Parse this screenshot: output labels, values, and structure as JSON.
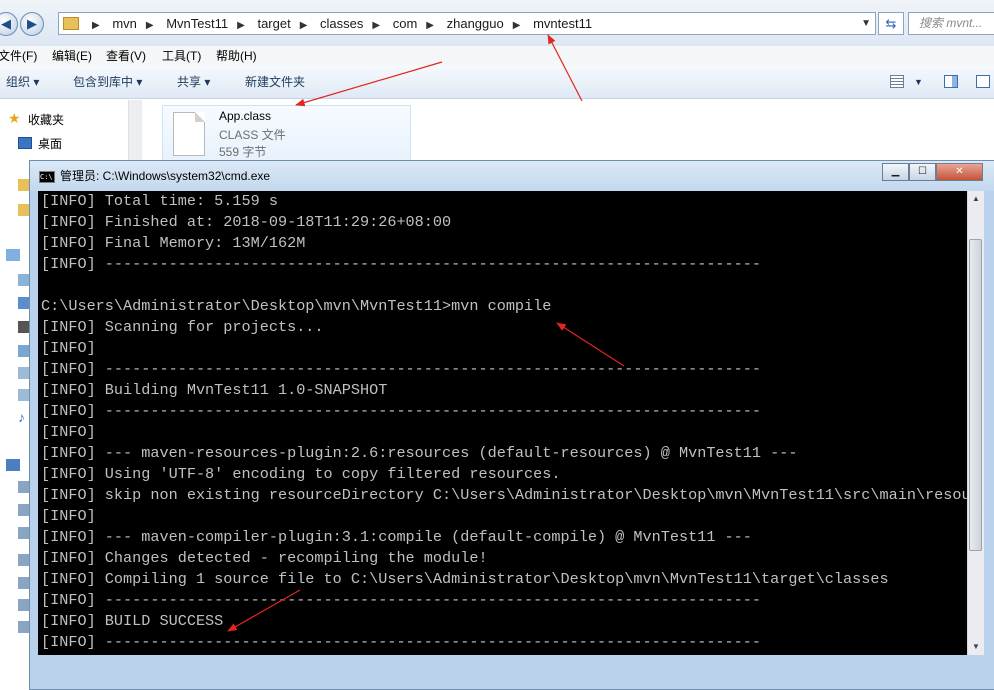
{
  "explorer": {
    "breadcrumb": [
      "mvn",
      "MvnTest11",
      "target",
      "classes",
      "com",
      "zhangguo",
      "mvntest11"
    ],
    "search_placeholder": "搜索 mvnt...",
    "menu": [
      "文件(F)",
      "编辑(E)",
      "查看(V)",
      "工具(T)",
      "帮助(H)"
    ],
    "toolbar": {
      "organize": "组织 ▾",
      "include_library": "包含到库中 ▾",
      "share": "共享 ▾",
      "new_folder": "新建文件夹"
    },
    "nav": {
      "favorites": "收藏夹",
      "desktop": "桌面"
    },
    "file": {
      "name": "App.class",
      "type": "CLASS 文件",
      "size": "559 字节"
    }
  },
  "cmd": {
    "title": "管理员: C:\\Windows\\system32\\cmd.exe",
    "icon_text": "C:\\",
    "lines": [
      "[INFO] Total time: 5.159 s",
      "[INFO] Finished at: 2018-09-18T11:29:26+08:00",
      "[INFO] Final Memory: 13M/162M",
      "[INFO] ------------------------------------------------------------------------",
      "",
      "C:\\Users\\Administrator\\Desktop\\mvn\\MvnTest11>mvn compile",
      "[INFO] Scanning for projects...",
      "[INFO]",
      "[INFO] ------------------------------------------------------------------------",
      "[INFO] Building MvnTest11 1.0-SNAPSHOT",
      "[INFO] ------------------------------------------------------------------------",
      "[INFO]",
      "[INFO] --- maven-resources-plugin:2.6:resources (default-resources) @ MvnTest11 ---",
      "[INFO] Using 'UTF-8' encoding to copy filtered resources.",
      "[INFO] skip non existing resourceDirectory C:\\Users\\Administrator\\Desktop\\mvn\\MvnTest11\\src\\main\\resour",
      "[INFO]",
      "[INFO] --- maven-compiler-plugin:3.1:compile (default-compile) @ MvnTest11 ---",
      "[INFO] Changes detected - recompiling the module!",
      "[INFO] Compiling 1 source file to C:\\Users\\Administrator\\Desktop\\mvn\\MvnTest11\\target\\classes",
      "[INFO] ------------------------------------------------------------------------",
      "[INFO] BUILD SUCCESS",
      "[INFO] ------------------------------------------------------------------------"
    ]
  },
  "colors": {
    "console_bg": "#000000",
    "console_text": "#c0c0c0",
    "annotation_arrow": "#e0261f"
  }
}
